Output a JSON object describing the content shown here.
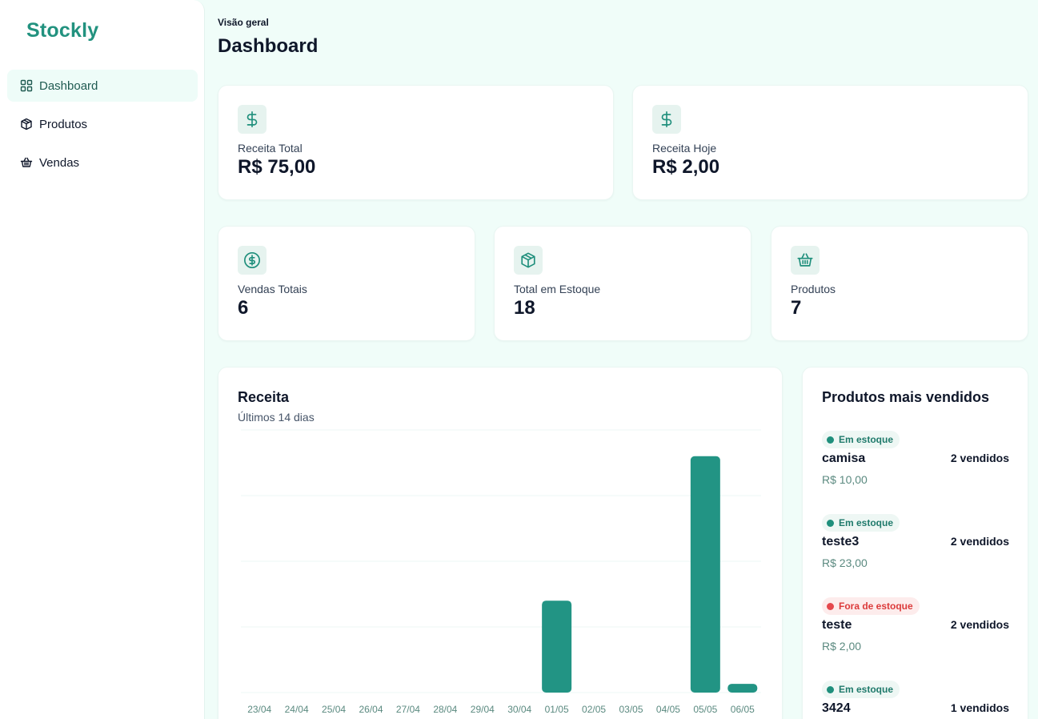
{
  "app": {
    "name": "Stockly"
  },
  "sidebar": {
    "items": [
      {
        "label": "Dashboard",
        "icon": "grid-icon",
        "active": true
      },
      {
        "label": "Produtos",
        "icon": "box-icon",
        "active": false
      },
      {
        "label": "Vendas",
        "icon": "basket-icon",
        "active": false
      }
    ]
  },
  "header": {
    "overline": "Visão geral",
    "title": "Dashboard"
  },
  "stats": {
    "receita_total": {
      "label": "Receita Total",
      "value": "R$ 75,00",
      "icon": "dollar-icon"
    },
    "receita_hoje": {
      "label": "Receita Hoje",
      "value": "R$ 2,00",
      "icon": "dollar-icon"
    },
    "vendas_totais": {
      "label": "Vendas Totais",
      "value": "6",
      "icon": "circle-dollar-icon"
    },
    "total_estoque": {
      "label": "Total em Estoque",
      "value": "18",
      "icon": "box-icon"
    },
    "produtos": {
      "label": "Produtos",
      "value": "7",
      "icon": "basket-icon"
    }
  },
  "chart": {
    "title": "Receita",
    "subtitle": "Últimos 14 dias"
  },
  "chart_data": {
    "type": "bar",
    "categories": [
      "23/04",
      "24/04",
      "25/04",
      "26/04",
      "27/04",
      "28/04",
      "29/04",
      "30/04",
      "01/05",
      "02/05",
      "03/05",
      "04/05",
      "05/05",
      "06/05"
    ],
    "values": [
      0,
      0,
      0,
      0,
      0,
      0,
      0,
      0,
      21,
      0,
      0,
      0,
      54,
      2
    ],
    "ylim": [
      0,
      60
    ],
    "grid": true,
    "color": "#229484"
  },
  "top_products": {
    "title": "Produtos mais vendidos",
    "items": [
      {
        "status": "Em estoque",
        "in_stock": true,
        "name": "camisa",
        "price": "R$ 10,00",
        "sold": "2 vendidos"
      },
      {
        "status": "Em estoque",
        "in_stock": true,
        "name": "teste3",
        "price": "R$ 23,00",
        "sold": "2 vendidos"
      },
      {
        "status": "Fora de estoque",
        "in_stock": false,
        "name": "teste",
        "price": "R$ 2,00",
        "sold": "2 vendidos"
      },
      {
        "status": "Em estoque",
        "in_stock": true,
        "name": "3424",
        "price": "",
        "sold": "1 vendidos"
      }
    ]
  },
  "colors": {
    "brand": "#22927f",
    "accent": "#229484",
    "danger": "#e5484d"
  }
}
